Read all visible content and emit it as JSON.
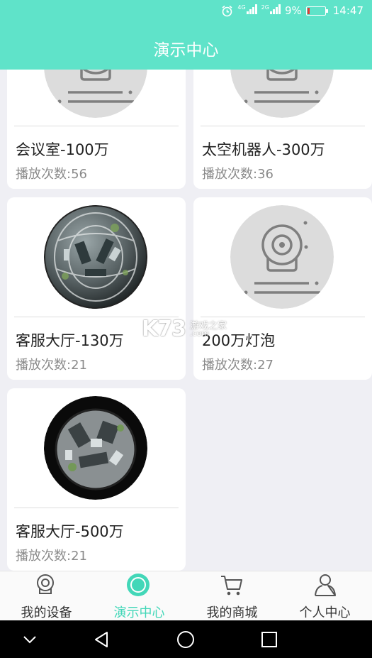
{
  "status_bar": {
    "net1": "4G",
    "net2": "2G",
    "battery": "9%",
    "time": "14:47",
    "battery_color": "#e53935"
  },
  "header": {
    "title": "演示中心",
    "background": "#5fe3c9"
  },
  "cards": [
    {
      "title": "会议室-100万",
      "count": "播放次数:56",
      "thumb": "camera-placeholder"
    },
    {
      "title": "太空机器人-300万",
      "count": "播放次数:36",
      "thumb": "camera-placeholder"
    },
    {
      "title": "客服大厅-130万",
      "count": "播放次数:21",
      "thumb": "fisheye-office-photo"
    },
    {
      "title": "200万灯泡",
      "count": "播放次数:27",
      "thumb": "camera-placeholder"
    },
    {
      "title": "客服大厅-500万",
      "count": "播放次数:21",
      "thumb": "fisheye-office-photo"
    }
  ],
  "watermark": {
    "logo": "K73",
    "cn": "游戏之家",
    "domain": ".com"
  },
  "tabs": [
    {
      "label": "我的设备",
      "icon": "camera-icon",
      "active": false
    },
    {
      "label": "演示中心",
      "icon": "demo-center-icon",
      "active": true
    },
    {
      "label": "我的商城",
      "icon": "cart-icon",
      "active": false
    },
    {
      "label": "个人中心",
      "icon": "person-icon",
      "active": false
    }
  ],
  "colors": {
    "accent": "#42d7b8",
    "placeholder_bg": "#dcdcdc",
    "placeholder_line": "#7f7f7f"
  },
  "nav": [
    "chevron-down-icon",
    "back-icon",
    "home-icon",
    "recents-icon"
  ]
}
